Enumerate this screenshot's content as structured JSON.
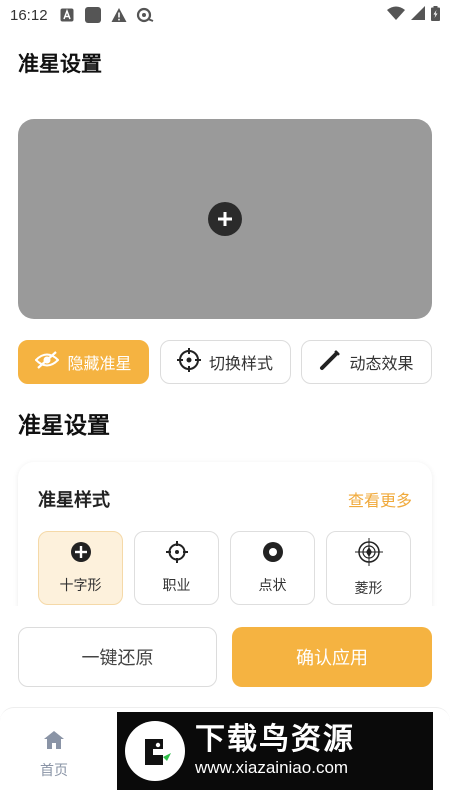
{
  "status_bar": {
    "time": "16:12"
  },
  "page": {
    "title": "准星设置"
  },
  "actions": [
    {
      "label": "隐藏准星",
      "icon": "eye-off-icon",
      "active": true
    },
    {
      "label": "切换样式",
      "icon": "crosshair-icon",
      "active": false
    },
    {
      "label": "动态效果",
      "icon": "pen-icon",
      "active": false
    }
  ],
  "section": {
    "title": "准星设置"
  },
  "style_card": {
    "title": "准星样式",
    "more": "查看更多",
    "items": [
      {
        "label": "十字形",
        "icon": "plus-circle-icon",
        "selected": true
      },
      {
        "label": "职业",
        "icon": "target-icon",
        "selected": false
      },
      {
        "label": "点状",
        "icon": "dot-circle-icon",
        "selected": false
      },
      {
        "label": "菱形",
        "icon": "diamond-scope-icon",
        "selected": false
      }
    ]
  },
  "bottom": {
    "reset": "一键还原",
    "apply": "确认应用"
  },
  "tabbar": {
    "home": "首页"
  },
  "watermark": {
    "title": "下载鸟资源",
    "url": "www.xiazainiao.com"
  },
  "colors": {
    "accent": "#f5b341",
    "accent_light": "#fdf1dc",
    "preview_bg": "#9a9a9a",
    "link": "#f0a93a"
  }
}
